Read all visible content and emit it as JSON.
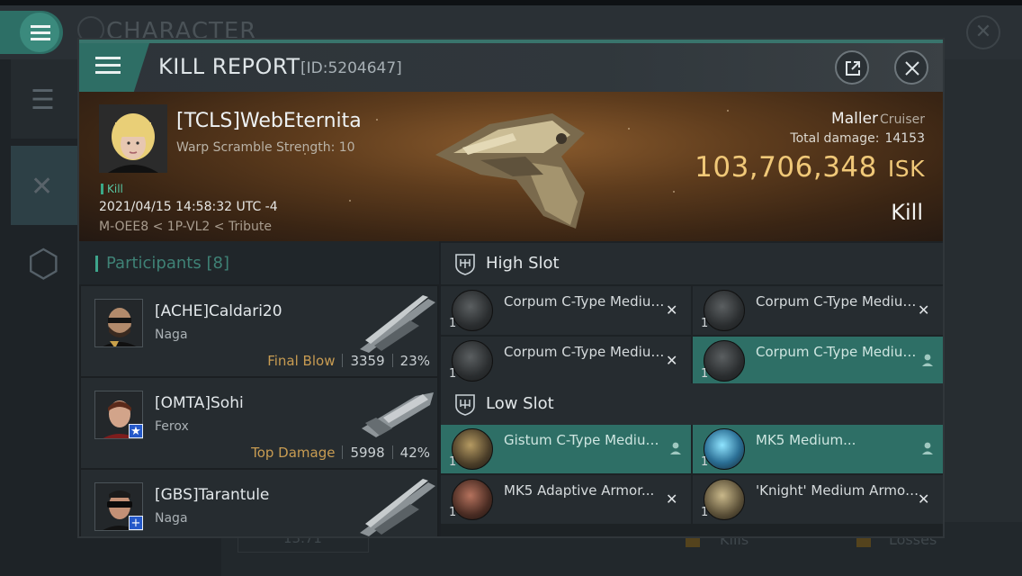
{
  "background": {
    "title": "CHARACTER",
    "close_glyph": "✕",
    "bottom_value": "13.71",
    "bottom_kills": "Kills",
    "bottom_losses": "Losses"
  },
  "header": {
    "title": "KILL REPORT",
    "id": "[ID:5204647]"
  },
  "victim": {
    "name": "[TCLS]WebEternita",
    "subtitle": "Warp Scramble Strength: 10",
    "tag": "Kill",
    "date": "2021/04/15 14:58:32 UTC -4",
    "location": "M-OEE8 < 1P-VL2 < Tribute",
    "ship_name": "Maller",
    "ship_class": "Cruiser",
    "total_damage_label": "Total damage:",
    "total_damage": "14153",
    "isk_value": "103,706,348",
    "isk_unit": "ISK",
    "result": "Kill"
  },
  "participants": {
    "label": "Participants",
    "count": "[8]",
    "rows": [
      {
        "name": "[ACHE]Caldari20",
        "ship": "Naga",
        "tag": "Final Blow",
        "damage": "3359",
        "percent": "23%"
      },
      {
        "name": "[OMTA]Sohi",
        "ship": "Ferox",
        "tag": "Top Damage",
        "damage": "5998",
        "percent": "42%"
      },
      {
        "name": "[GBS]Tarantule",
        "ship": "Naga",
        "tag": "",
        "damage": "",
        "percent": ""
      }
    ]
  },
  "slots": {
    "high_label": "High Slot",
    "low_label": "Low Slot",
    "high_items": [
      {
        "name": "Corpum C-Type Medium...",
        "qty": "1",
        "state": "destroyed"
      },
      {
        "name": "Corpum C-Type Medium...",
        "qty": "1",
        "state": "destroyed"
      },
      {
        "name": "Corpum C-Type Medium...",
        "qty": "1",
        "state": "destroyed"
      },
      {
        "name": "Corpum C-Type Medium...",
        "qty": "1",
        "state": "dropped"
      }
    ],
    "low_items": [
      {
        "name": "Gistum C-Type Medium...",
        "qty": "1",
        "state": "dropped"
      },
      {
        "name": "MK5 Medium...",
        "qty": "1",
        "state": "dropped"
      },
      {
        "name": "MK5 Adaptive Armor...",
        "qty": "1",
        "state": "destroyed"
      },
      {
        "name": "'Knight' Medium Armor...",
        "qty": "1",
        "state": "destroyed"
      }
    ],
    "destroyed_glyph": "✕"
  },
  "colors": {
    "accent": "#2e6f66",
    "isk": "#f0c878",
    "final_blow": "#c89c52"
  }
}
